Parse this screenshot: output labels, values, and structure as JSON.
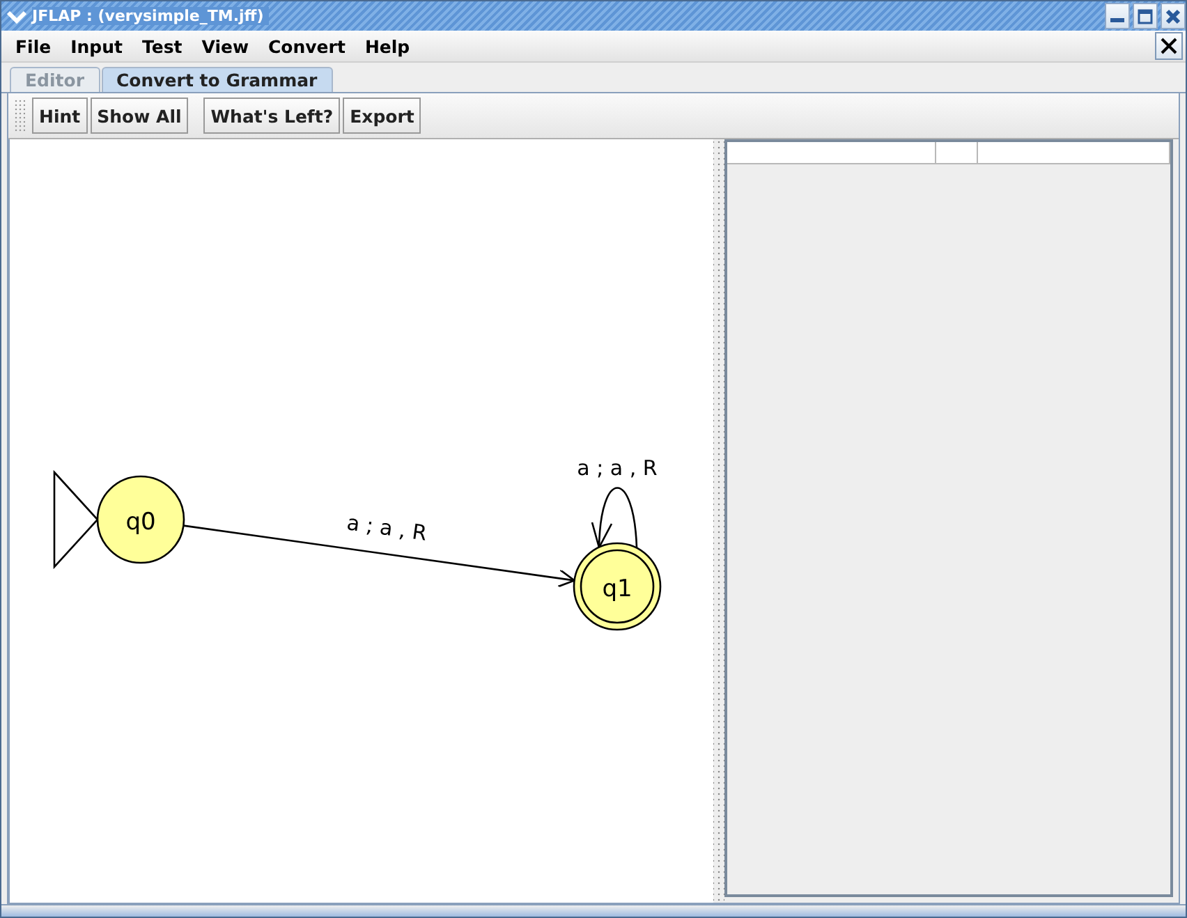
{
  "window": {
    "title": "JFLAP : (verysimple_TM.jff)"
  },
  "menu": [
    "File",
    "Input",
    "Test",
    "View",
    "Convert",
    "Help"
  ],
  "tabs": [
    {
      "label": "Editor",
      "selected": false
    },
    {
      "label": "Convert to Grammar",
      "selected": true
    }
  ],
  "toolbar": [
    [
      "Hint",
      "Show All"
    ],
    [
      "What's Left?",
      "Export"
    ]
  ],
  "diagram": {
    "states": [
      {
        "name": "q0",
        "initial": true,
        "final": false,
        "edge_to_next": "a ; a , R"
      },
      {
        "name": "q1",
        "initial": false,
        "final": true,
        "self_loop": "a ; a , R"
      }
    ]
  }
}
